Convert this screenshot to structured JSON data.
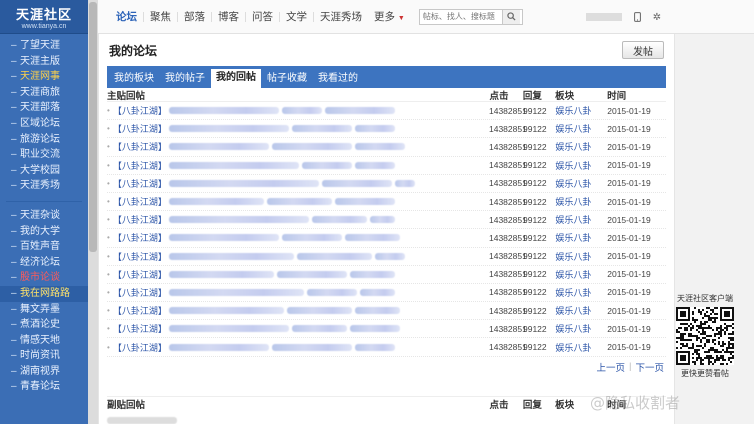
{
  "logo": {
    "main": "天涯社区",
    "sub": "www.tianya.cn"
  },
  "sidebar": {
    "group1": [
      {
        "label": "了望天涯",
        "state": ""
      },
      {
        "label": "天涯主版",
        "state": ""
      },
      {
        "label": "天涯网事",
        "state": "active"
      },
      {
        "label": "天涯商旅",
        "state": ""
      },
      {
        "label": "天涯部落",
        "state": ""
      },
      {
        "label": "区域论坛",
        "state": ""
      },
      {
        "label": "旅游论坛",
        "state": ""
      },
      {
        "label": "职业交流",
        "state": ""
      },
      {
        "label": "大学校园",
        "state": ""
      },
      {
        "label": "天涯秀场",
        "state": ""
      }
    ],
    "group2": [
      {
        "label": "天涯杂谈",
        "state": ""
      },
      {
        "label": "我的大学",
        "state": ""
      },
      {
        "label": "百姓声音",
        "state": ""
      },
      {
        "label": "经济论坛",
        "state": ""
      },
      {
        "label": "股市论谈",
        "state": "hot"
      },
      {
        "label": "我在网路路",
        "state": "hot-bg"
      },
      {
        "label": "舞文弄墨",
        "state": ""
      },
      {
        "label": "煮酒论史",
        "state": ""
      },
      {
        "label": "情感天地",
        "state": ""
      },
      {
        "label": "时尚资讯",
        "state": ""
      },
      {
        "label": "湖南视界",
        "state": ""
      },
      {
        "label": "青春论坛",
        "state": ""
      }
    ]
  },
  "topnav": {
    "items": [
      "论坛",
      "聚焦",
      "部落",
      "博客",
      "问答",
      "文学",
      "天涯秀场"
    ],
    "more": "更多",
    "search_placeholder": "帖标、找人、搜标题"
  },
  "main": {
    "title": "我的论坛",
    "post_button": "发帖",
    "tabs": [
      "我的板块",
      "我的帖子",
      "我的回帖",
      "帖子收藏",
      "我看过的"
    ],
    "columns": [
      "主贴回帖",
      "点击",
      "回复",
      "板块",
      "时间"
    ],
    "rows": [
      {
        "tag": "【八卦江湖】",
        "clicks": "14382851",
        "replies": "99122",
        "board": "娱乐八卦",
        "time": "2015-01-19"
      },
      {
        "tag": "【八卦江湖】",
        "clicks": "14382851",
        "replies": "99122",
        "board": "娱乐八卦",
        "time": "2015-01-19"
      },
      {
        "tag": "【八卦江湖】",
        "clicks": "14382851",
        "replies": "99122",
        "board": "娱乐八卦",
        "time": "2015-01-19"
      },
      {
        "tag": "【八卦江湖】",
        "clicks": "14382851",
        "replies": "99122",
        "board": "娱乐八卦",
        "time": "2015-01-19"
      },
      {
        "tag": "【八卦江湖】",
        "clicks": "14382851",
        "replies": "99122",
        "board": "娱乐八卦",
        "time": "2015-01-19"
      },
      {
        "tag": "【八卦江湖】",
        "clicks": "14382851",
        "replies": "99122",
        "board": "娱乐八卦",
        "time": "2015-01-19"
      },
      {
        "tag": "【八卦江湖】",
        "clicks": "14382851",
        "replies": "99122",
        "board": "娱乐八卦",
        "time": "2015-01-19"
      },
      {
        "tag": "【八卦江湖】",
        "clicks": "14382851",
        "replies": "99122",
        "board": "娱乐八卦",
        "time": "2015-01-19"
      },
      {
        "tag": "【八卦江湖】",
        "clicks": "14382851",
        "replies": "99122",
        "board": "娱乐八卦",
        "time": "2015-01-19"
      },
      {
        "tag": "【八卦江湖】",
        "clicks": "14382851",
        "replies": "99122",
        "board": "娱乐八卦",
        "time": "2015-01-19"
      },
      {
        "tag": "【八卦江湖】",
        "clicks": "14382851",
        "replies": "99122",
        "board": "娱乐八卦",
        "time": "2015-01-19"
      },
      {
        "tag": "【八卦江湖】",
        "clicks": "14382851",
        "replies": "99122",
        "board": "娱乐八卦",
        "time": "2015-01-19"
      },
      {
        "tag": "【八卦江湖】",
        "clicks": "14382851",
        "replies": "99122",
        "board": "娱乐八卦",
        "time": "2015-01-19"
      },
      {
        "tag": "【八卦江湖】",
        "clicks": "14382851",
        "replies": "99122",
        "board": "娱乐八卦",
        "time": "2015-01-19"
      }
    ],
    "pager": {
      "prev": "上一页",
      "next": "下一页"
    },
    "sub_columns": [
      "副贴回帖",
      "点击",
      "回复",
      "板块",
      "时间"
    ]
  },
  "qr": {
    "label": "天涯社区客户端",
    "caption": "更快更赞看帖"
  },
  "watermark": "@隐私收割者",
  "colors": {
    "sidebar": "#3b6eb5",
    "tab_bar": "#3d74c0",
    "link": "#2c55a8"
  },
  "icons": [
    "search-icon",
    "mobile-icon",
    "gear-icon",
    "chevron-down-icon",
    "qr-code-icon"
  ]
}
